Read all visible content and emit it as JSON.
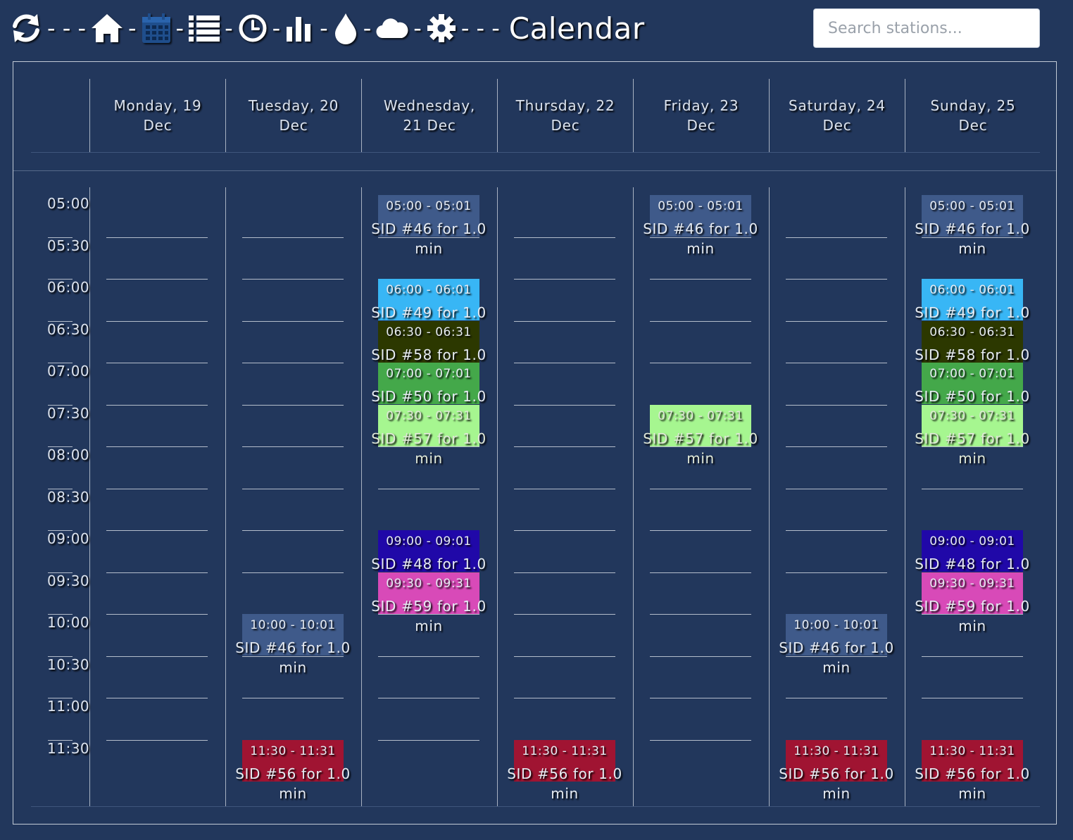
{
  "nav": {
    "icons": [
      "refresh-icon",
      "home-icon",
      "calendar-icon",
      "list-icon",
      "clock-icon",
      "bar-chart-icon",
      "water-drop-icon",
      "cloud-icon",
      "gear-icon"
    ],
    "separators": [
      "- - -",
      "-",
      "-",
      "-",
      "-",
      "-",
      "-",
      "-",
      "- - -"
    ],
    "title": "Calendar",
    "active_color": "#1f4e8c"
  },
  "search": {
    "placeholder": "Search stations..."
  },
  "calendar": {
    "days": [
      "Monday, 19 Dec",
      "Tuesday, 20 Dec",
      "Wednesday, 21 Dec",
      "Thursday, 22 Dec",
      "Friday, 23 Dec",
      "Saturday, 24 Dec",
      "Sunday, 25 Dec"
    ],
    "times": [
      "05:00",
      "05:30",
      "06:00",
      "06:30",
      "07:00",
      "07:30",
      "08:00",
      "08:30",
      "09:00",
      "09:30",
      "10:00",
      "10:30",
      "11:00",
      "11:30"
    ],
    "events": [
      {
        "day": 2,
        "slot": 0,
        "time": "05:00 - 05:01",
        "title": "SID #46 for 1.0 min",
        "color": "#3f5a8a"
      },
      {
        "day": 2,
        "slot": 2,
        "time": "06:00 - 06:01",
        "title": "SID #49 for 1.0 min",
        "color": "#38b6f5"
      },
      {
        "day": 2,
        "slot": 3,
        "time": "06:30 - 06:31",
        "title": "SID #58 for 1.0 min",
        "color": "#2c3800"
      },
      {
        "day": 2,
        "slot": 4,
        "time": "07:00 - 07:01",
        "title": "SID #50 for 1.0 min",
        "color": "#44a84a"
      },
      {
        "day": 2,
        "slot": 5,
        "time": "07:30 - 07:31",
        "title": "SID #57 for 1.0 min",
        "color": "#a6f690"
      },
      {
        "day": 2,
        "slot": 8,
        "time": "09:00 - 09:01",
        "title": "SID #48 for 1.0 min",
        "color": "#2008a8"
      },
      {
        "day": 2,
        "slot": 9,
        "time": "09:30 - 09:31",
        "title": "SID #59 for 1.0 min",
        "color": "#d84ab8"
      },
      {
        "day": 4,
        "slot": 0,
        "time": "05:00 - 05:01",
        "title": "SID #46 for 1.0 min",
        "color": "#3f5a8a"
      },
      {
        "day": 4,
        "slot": 5,
        "time": "07:30 - 07:31",
        "title": "SID #57 for 1.0 min",
        "color": "#a6f690"
      },
      {
        "day": 6,
        "slot": 0,
        "time": "05:00 - 05:01",
        "title": "SID #46 for 1.0 min",
        "color": "#3f5a8a"
      },
      {
        "day": 6,
        "slot": 2,
        "time": "06:00 - 06:01",
        "title": "SID #49 for 1.0 min",
        "color": "#38b6f5"
      },
      {
        "day": 6,
        "slot": 3,
        "time": "06:30 - 06:31",
        "title": "SID #58 for 1.0 min",
        "color": "#2c3800"
      },
      {
        "day": 6,
        "slot": 4,
        "time": "07:00 - 07:01",
        "title": "SID #50 for 1.0 min",
        "color": "#44a84a"
      },
      {
        "day": 6,
        "slot": 5,
        "time": "07:30 - 07:31",
        "title": "SID #57 for 1.0 min",
        "color": "#a6f690"
      },
      {
        "day": 6,
        "slot": 8,
        "time": "09:00 - 09:01",
        "title": "SID #48 for 1.0 min",
        "color": "#2008a8"
      },
      {
        "day": 6,
        "slot": 9,
        "time": "09:30 - 09:31",
        "title": "SID #59 for 1.0 min",
        "color": "#d84ab8"
      },
      {
        "day": 1,
        "slot": 10,
        "time": "10:00 - 10:01",
        "title": "SID #46 for 1.0 min",
        "color": "#3f5a8a"
      },
      {
        "day": 5,
        "slot": 10,
        "time": "10:00 - 10:01",
        "title": "SID #46 for 1.0 min",
        "color": "#3f5a8a"
      },
      {
        "day": 1,
        "slot": 13,
        "time": "11:30 - 11:31",
        "title": "SID #56 for 1.0 min",
        "color": "#a01432"
      },
      {
        "day": 3,
        "slot": 13,
        "time": "11:30 - 11:31",
        "title": "SID #56 for 1.0 min",
        "color": "#a01432"
      },
      {
        "day": 5,
        "slot": 13,
        "time": "11:30 - 11:31",
        "title": "SID #56 for 1.0 min",
        "color": "#a01432"
      },
      {
        "day": 6,
        "slot": 13,
        "time": "11:30 - 11:31",
        "title": "SID #56 for 1.0 min",
        "color": "#a01432"
      }
    ]
  }
}
